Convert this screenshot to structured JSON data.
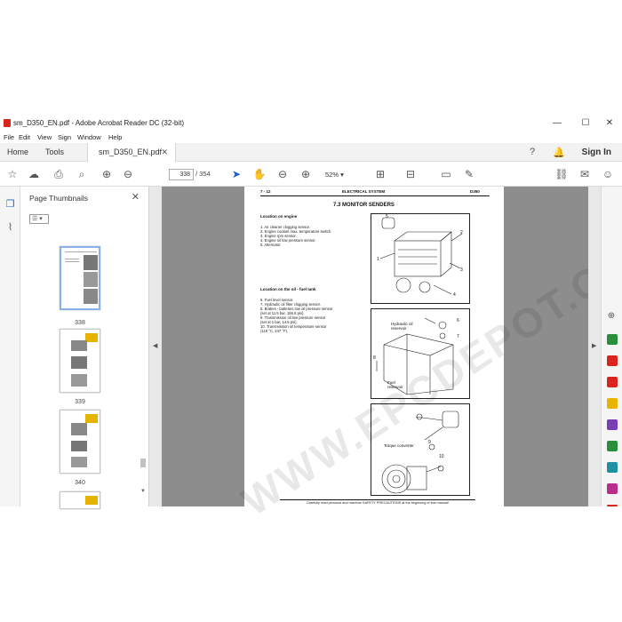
{
  "window": {
    "title": "sm_D350_EN.pdf - Adobe Acrobat Reader DC (32-bit)",
    "minimize": "—",
    "maximize": "☐",
    "close": "✕"
  },
  "menu": [
    "File",
    "Edit",
    "View",
    "Sign",
    "Window",
    "Help"
  ],
  "tabs": {
    "home": "Home",
    "tools": "Tools",
    "document": "sm_D350_EN.pdf",
    "sign_in": "Sign In"
  },
  "toolbar": {
    "current_page": "338",
    "page_separator": "/ 354",
    "zoom": "52%"
  },
  "thumbnails": {
    "header": "Page Thumbnails",
    "pages": [
      "338",
      "339",
      "340"
    ]
  },
  "document": {
    "page_header_left": "7 - 12",
    "page_header_center": "ELECTRICAL SYSTEM",
    "page_header_right": "D350",
    "section_title": "7.3  MONITOR SENDERS",
    "engine_heading": "Location on engine",
    "engine_items": [
      "1.  Air cleaner clogging sensor.",
      "2.  Engine coolant max. temperature switch.",
      "3.  Engine rpm sensor.",
      "4.  Engine oil low pressure sensor.",
      "5.  Alternator."
    ],
    "tank_heading": "Location on the oil - fuel tank",
    "tank_items": [
      "6.   Fuel level sensor.",
      "7.   Hydraulic oil filter clogging sensor.",
      "8.   Brakes - batteries low oil pressure sensor",
      "      (set at 11.5 bar, 166.8 psi).",
      "9.   Transmission oil low pressure sensor",
      "      (set at 1 bar, 14.5 psi).",
      "10. Transmission oil temperature sensor",
      "      (119 °C, 247 °F)."
    ],
    "fig2_label_hydraulic": "Hydraulic oil reservoir",
    "fig2_label_fuel": "Fuel reservoir",
    "fig3_label_torque": "Torque converter",
    "footer": "Carefully read personal and machine SAFETY PRECAUTIONS at the beginning of this manual!",
    "watermark": "WWW.EPCDEPOT.COM"
  }
}
